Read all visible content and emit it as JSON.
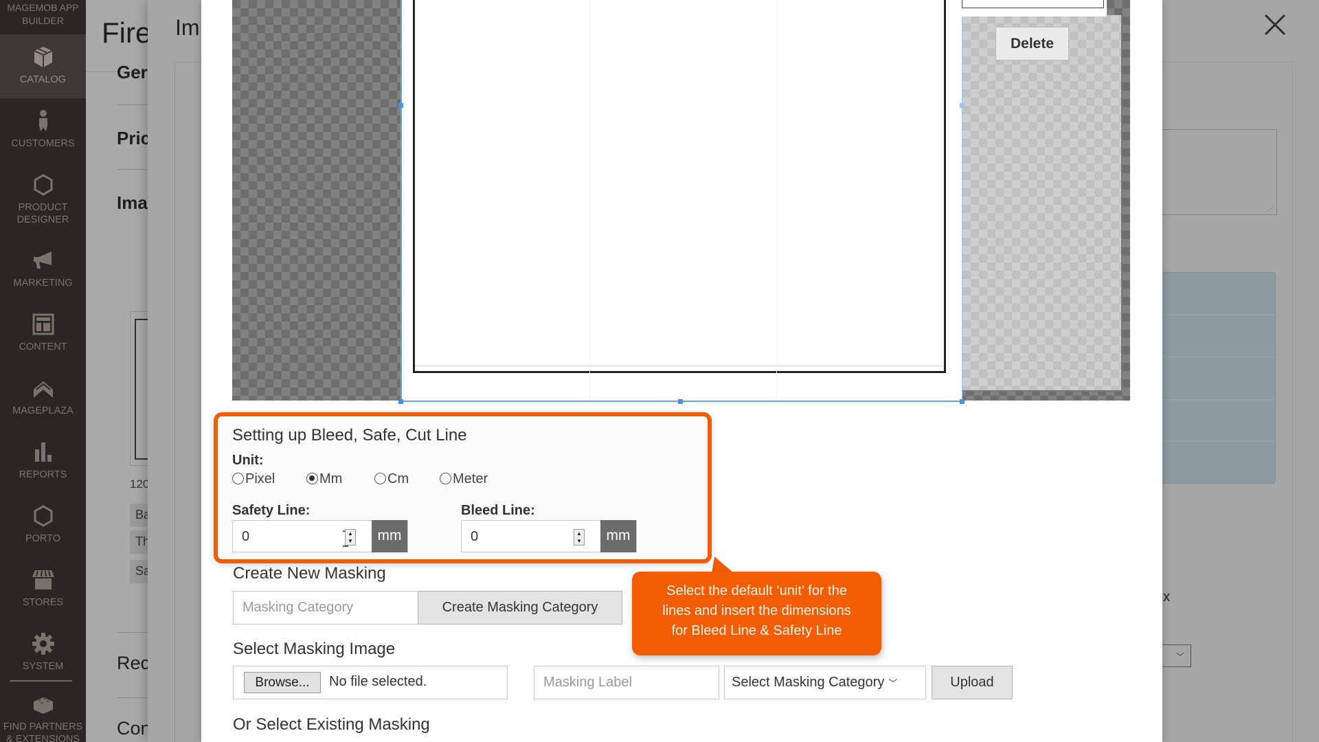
{
  "sidebar": {
    "logo": "MAGEMOB APP BUILDER",
    "items": [
      {
        "label": "CATALOG",
        "icon": "box-icon",
        "active": true
      },
      {
        "label": "CUSTOMERS",
        "icon": "person-icon",
        "active": false
      },
      {
        "label": "PRODUCT DESIGNER",
        "icon": "hexagon-icon",
        "active": false
      },
      {
        "label": "MARKETING",
        "icon": "megaphone-icon",
        "active": false
      },
      {
        "label": "CONTENT",
        "icon": "layout-icon",
        "active": false
      },
      {
        "label": "MAGEPLAZA",
        "icon": "chevron-up-icon",
        "active": false
      },
      {
        "label": "REPORTS",
        "icon": "bar-chart-icon",
        "active": false
      },
      {
        "label": "PORTO",
        "icon": "hexagon-icon",
        "active": false
      },
      {
        "label": "STORES",
        "icon": "storefront-icon",
        "active": false
      },
      {
        "label": "SYSTEM",
        "icon": "gear-icon",
        "active": false
      },
      {
        "label": "FIND PARTNERS & EXTENSIONS",
        "icon": "lego-brick-icon",
        "active": false
      }
    ]
  },
  "background_page": {
    "title": "Fire",
    "sections": [
      "Ger",
      "Pric",
      "Ima",
      "Rec",
      "Con"
    ],
    "image_size": "120",
    "tags": [
      "Ba",
      "Th",
      "Sa"
    ]
  },
  "background_modal": {
    "title": "Im",
    "right_label": "ox"
  },
  "canvas": {
    "delete_label": "Delete"
  },
  "bleed_settings": {
    "title": "Setting up Bleed, Safe, Cut Line",
    "unit_label": "Unit:",
    "units": [
      {
        "label": "Pixel",
        "selected": false
      },
      {
        "label": "Mm",
        "selected": true
      },
      {
        "label": "Cm",
        "selected": false
      },
      {
        "label": "Meter",
        "selected": false
      }
    ],
    "safety_line": {
      "label": "Safety Line:",
      "value": "0",
      "unit": "mm"
    },
    "bleed_line": {
      "label": "Bleed Line:",
      "value": "0",
      "unit": "mm"
    }
  },
  "callout": {
    "text_lines": [
      "Select the default ‘unit’ for the",
      "lines and insert the dimensions",
      "for Bleed Line & Safety Line"
    ],
    "color": "#f25c05"
  },
  "create_masking": {
    "heading": "Create New Masking",
    "category_placeholder": "Masking Category",
    "create_button": "Create Masking Category"
  },
  "select_masking_image": {
    "heading": "Select Masking Image",
    "browse_button": "Browse...",
    "file_status": "No file selected.",
    "label_placeholder": "Masking Label",
    "category_select": "Select Masking Category",
    "upload_button": "Upload"
  },
  "existing_masking": {
    "heading": "Or Select Existing Masking"
  }
}
